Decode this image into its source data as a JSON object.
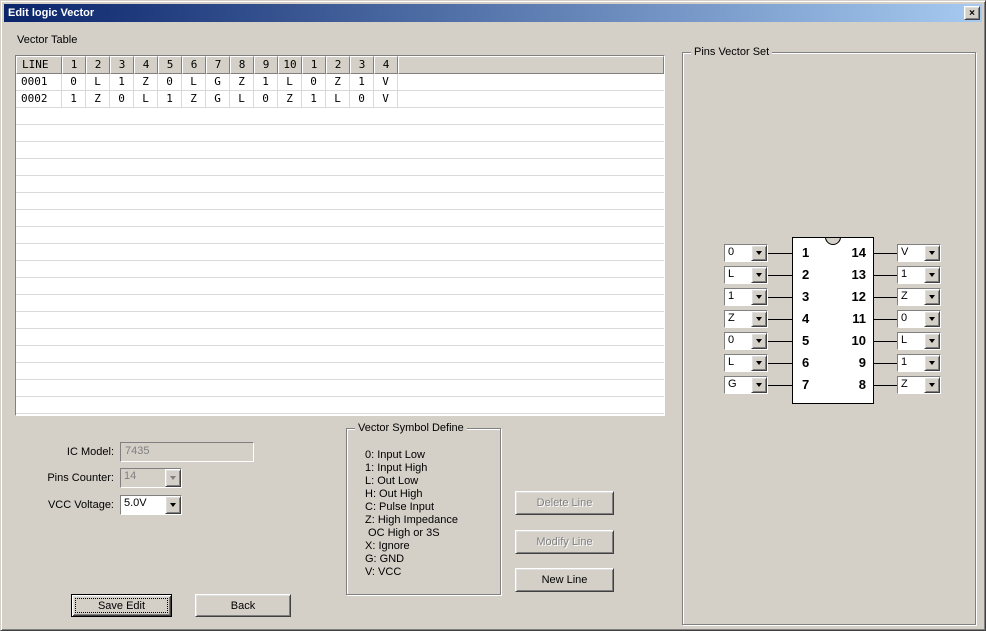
{
  "colors": {
    "dialog_bg": "#d4d0c8",
    "titlebar_start": "#0a246a",
    "titlebar_end": "#a6caf0",
    "disabled_text": "#808080"
  },
  "window": {
    "title": "Edit logic Vector",
    "close_glyph": "×"
  },
  "vector_table": {
    "label": "Vector Table",
    "headers": [
      "LINE",
      "1",
      "2",
      "3",
      "4",
      "5",
      "6",
      "7",
      "8",
      "9",
      "10",
      "1",
      "2",
      "3",
      "4"
    ],
    "rows": [
      {
        "line": "0001",
        "values": [
          "0",
          "L",
          "1",
          "Z",
          "0",
          "L",
          "G",
          "Z",
          "1",
          "L",
          "0",
          "Z",
          "1",
          "V"
        ]
      },
      {
        "line": "0002",
        "values": [
          "1",
          "Z",
          "0",
          "L",
          "1",
          "Z",
          "G",
          "L",
          "0",
          "Z",
          "1",
          "L",
          "0",
          "V"
        ]
      }
    ],
    "empty_row_count": 18
  },
  "ic_settings": {
    "ic_model_label": "IC Model:",
    "ic_model_value": "7435",
    "pins_counter_label": "Pins Counter:",
    "pins_counter_value": "14",
    "vcc_voltage_label": "VCC Voltage:",
    "vcc_voltage_value": "5.0V"
  },
  "symbol_define": {
    "label": "Vector Symbol Define",
    "lines": [
      "0: Input Low",
      "1: Input High",
      "L: Out Low",
      "H: Out High",
      "C: Pulse Input",
      "Z: High Impedance",
      " OC High or 3S",
      "X: Ignore",
      "G: GND",
      "V: VCC"
    ]
  },
  "line_buttons": {
    "delete": "Delete Line",
    "modify": "Modify Line",
    "new_line": "New Line"
  },
  "footer_buttons": {
    "save": "Save Edit",
    "back": "Back"
  },
  "pins_vector_set": {
    "label": "Pins Vector Set",
    "left_pins": [
      {
        "number": "1",
        "value": "0"
      },
      {
        "number": "2",
        "value": "L"
      },
      {
        "number": "3",
        "value": "1"
      },
      {
        "number": "4",
        "value": "Z"
      },
      {
        "number": "5",
        "value": "0"
      },
      {
        "number": "6",
        "value": "L"
      },
      {
        "number": "7",
        "value": "G"
      }
    ],
    "right_pins": [
      {
        "number": "14",
        "value": "V"
      },
      {
        "number": "13",
        "value": "1"
      },
      {
        "number": "12",
        "value": "Z"
      },
      {
        "number": "11",
        "value": "0"
      },
      {
        "number": "10",
        "value": "L"
      },
      {
        "number": "9",
        "value": "1"
      },
      {
        "number": "8",
        "value": "Z"
      }
    ]
  }
}
